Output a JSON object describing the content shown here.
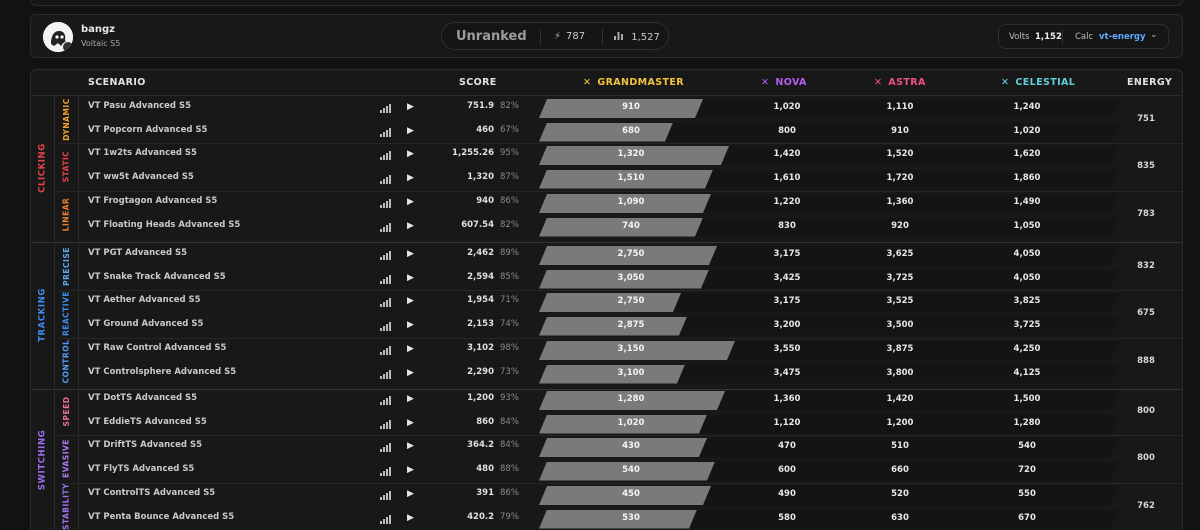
{
  "profile": {
    "username": "bangz",
    "subtitle": "Voltaic S5"
  },
  "rank": {
    "label": "Unranked",
    "energy": "787",
    "count": "1,527"
  },
  "volts": {
    "label": "Volts",
    "value": "1,152",
    "calc_label": "Calc",
    "calc_value": "vt-energy"
  },
  "columns": {
    "scenario": "SCENARIO",
    "score": "SCORE",
    "grandmaster": "GRANDMASTER",
    "nova": "NOVA",
    "astra": "ASTRA",
    "celestial": "CELESTIAL",
    "energy": "ENERGY"
  },
  "colors": {
    "grandmaster": "#f2c53d",
    "nova": "#b55cf2",
    "astra": "#f0508a",
    "celestial": "#5fd0d8",
    "clicking": "#e8434a",
    "tracking": "#3f8cf0",
    "switching": "#a16cf2"
  },
  "categories": [
    {
      "name": "CLICKING",
      "color": "#e8434a",
      "subcategories": [
        {
          "name": "DYNAMIC",
          "color": "#f0a030",
          "energy": "751",
          "rows": [
            {
              "name": "VT Pasu Advanced S5",
              "score": "751.9",
              "pct": "82%",
              "fill_pct": 82,
              "gm": "910",
              "nova": "1,020",
              "astra": "1,110",
              "celestial": "1,240"
            },
            {
              "name": "VT Popcorn Advanced S5",
              "score": "460",
              "pct": "67%",
              "fill_pct": 67,
              "gm": "680",
              "nova": "800",
              "astra": "910",
              "celestial": "1,020"
            }
          ]
        },
        {
          "name": "STATIC",
          "color": "#e8434a",
          "energy": "835",
          "rows": [
            {
              "name": "VT 1w2ts Advanced S5",
              "score": "1,255.26",
              "pct": "95%",
              "fill_pct": 95,
              "gm": "1,320",
              "nova": "1,420",
              "astra": "1,520",
              "celestial": "1,620"
            },
            {
              "name": "VT ww5t Advanced S5",
              "score": "1,320",
              "pct": "87%",
              "fill_pct": 87,
              "gm": "1,510",
              "nova": "1,610",
              "astra": "1,720",
              "celestial": "1,860"
            }
          ]
        },
        {
          "name": "LINEAR",
          "color": "#f08030",
          "energy": "783",
          "rows": [
            {
              "name": "VT Frogtagon Advanced S5",
              "score": "940",
              "pct": "86%",
              "fill_pct": 86,
              "gm": "1,090",
              "nova": "1,220",
              "astra": "1,360",
              "celestial": "1,490"
            },
            {
              "name": "VT Floating Heads Advanced S5",
              "score": "607.54",
              "pct": "82%",
              "fill_pct": 82,
              "gm": "740",
              "nova": "830",
              "astra": "920",
              "celestial": "1,050"
            }
          ]
        }
      ]
    },
    {
      "name": "TRACKING",
      "color": "#3f8cf0",
      "subcategories": [
        {
          "name": "PRECISE",
          "color": "#5aa8f0",
          "energy": "832",
          "rows": [
            {
              "name": "VT PGT Advanced S5",
              "score": "2,462",
              "pct": "89%",
              "fill_pct": 89,
              "gm": "2,750",
              "nova": "3,175",
              "astra": "3,625",
              "celestial": "4,050"
            },
            {
              "name": "VT Snake Track Advanced S5",
              "score": "2,594",
              "pct": "85%",
              "fill_pct": 85,
              "gm": "3,050",
              "nova": "3,425",
              "astra": "3,725",
              "celestial": "4,050"
            }
          ]
        },
        {
          "name": "REACTIVE",
          "color": "#3f8cf0",
          "energy": "675",
          "rows": [
            {
              "name": "VT Aether Advanced S5",
              "score": "1,954",
              "pct": "71%",
              "fill_pct": 71,
              "gm": "2,750",
              "nova": "3,175",
              "astra": "3,525",
              "celestial": "3,825"
            },
            {
              "name": "VT Ground Advanced S5",
              "score": "2,153",
              "pct": "74%",
              "fill_pct": 74,
              "gm": "2,875",
              "nova": "3,200",
              "astra": "3,500",
              "celestial": "3,725"
            }
          ]
        },
        {
          "name": "CONTROL",
          "color": "#4f9ef5",
          "energy": "888",
          "rows": [
            {
              "name": "VT Raw Control Advanced S5",
              "score": "3,102",
              "pct": "98%",
              "fill_pct": 98,
              "gm": "3,150",
              "nova": "3,550",
              "astra": "3,875",
              "celestial": "4,250"
            },
            {
              "name": "VT Controlsphere Advanced S5",
              "score": "2,290",
              "pct": "73%",
              "fill_pct": 73,
              "gm": "3,100",
              "nova": "3,475",
              "astra": "3,800",
              "celestial": "4,125"
            }
          ]
        }
      ]
    },
    {
      "name": "SWITCHING",
      "color": "#a16cf2",
      "subcategories": [
        {
          "name": "SPEED",
          "color": "#f06aa0",
          "energy": "800",
          "rows": [
            {
              "name": "VT DotTS Advanced S5",
              "score": "1,200",
              "pct": "93%",
              "fill_pct": 93,
              "gm": "1,280",
              "nova": "1,360",
              "astra": "1,420",
              "celestial": "1,500"
            },
            {
              "name": "VT EddieTS Advanced S5",
              "score": "860",
              "pct": "84%",
              "fill_pct": 84,
              "gm": "1,020",
              "nova": "1,120",
              "astra": "1,200",
              "celestial": "1,280"
            }
          ]
        },
        {
          "name": "EVASIVE",
          "color": "#b07af5",
          "energy": "800",
          "rows": [
            {
              "name": "VT DriftTS Advanced S5",
              "score": "364.2",
              "pct": "84%",
              "fill_pct": 84,
              "gm": "430",
              "nova": "470",
              "astra": "510",
              "celestial": "540"
            },
            {
              "name": "VT FlyTS Advanced S5",
              "score": "480",
              "pct": "88%",
              "fill_pct": 88,
              "gm": "540",
              "nova": "600",
              "astra": "660",
              "celestial": "720"
            }
          ]
        },
        {
          "name": "STABILITY",
          "color": "#a070f0",
          "energy": "762",
          "rows": [
            {
              "name": "VT ControlTS Advanced S5",
              "score": "391",
              "pct": "86%",
              "fill_pct": 86,
              "gm": "450",
              "nova": "490",
              "astra": "520",
              "celestial": "550"
            },
            {
              "name": "VT Penta Bounce Advanced S5",
              "score": "420.2",
              "pct": "79%",
              "fill_pct": 79,
              "gm": "530",
              "nova": "580",
              "astra": "630",
              "celestial": "670"
            }
          ]
        }
      ]
    }
  ]
}
